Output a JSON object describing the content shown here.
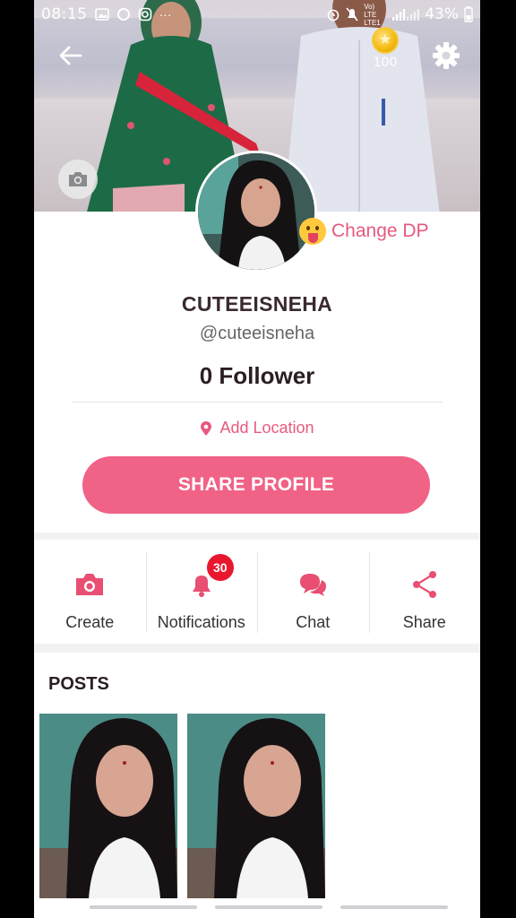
{
  "status_bar": {
    "time": "08:15",
    "network_label": "Vo) LTE LTE1",
    "battery": "43%"
  },
  "header": {
    "coin_count": "100"
  },
  "profile": {
    "change_dp_label": "Change DP",
    "display_name": "CUTEEISNEHA",
    "handle": "@cuteeisneha",
    "followers": "0 Follower",
    "add_location_label": "Add Location",
    "share_button_label": "SHARE PROFILE"
  },
  "actions": [
    {
      "label": "Create",
      "icon": "camera-icon"
    },
    {
      "label": "Notifications",
      "icon": "bell-icon",
      "badge": "30"
    },
    {
      "label": "Chat",
      "icon": "chat-bubbles-icon"
    },
    {
      "label": "Share",
      "icon": "share-icon"
    }
  ],
  "posts": {
    "title": "POSTS",
    "count": 2
  },
  "colors": {
    "accent": "#f06286",
    "accent_text": "#e65a7d",
    "badge": "#e8172e"
  }
}
